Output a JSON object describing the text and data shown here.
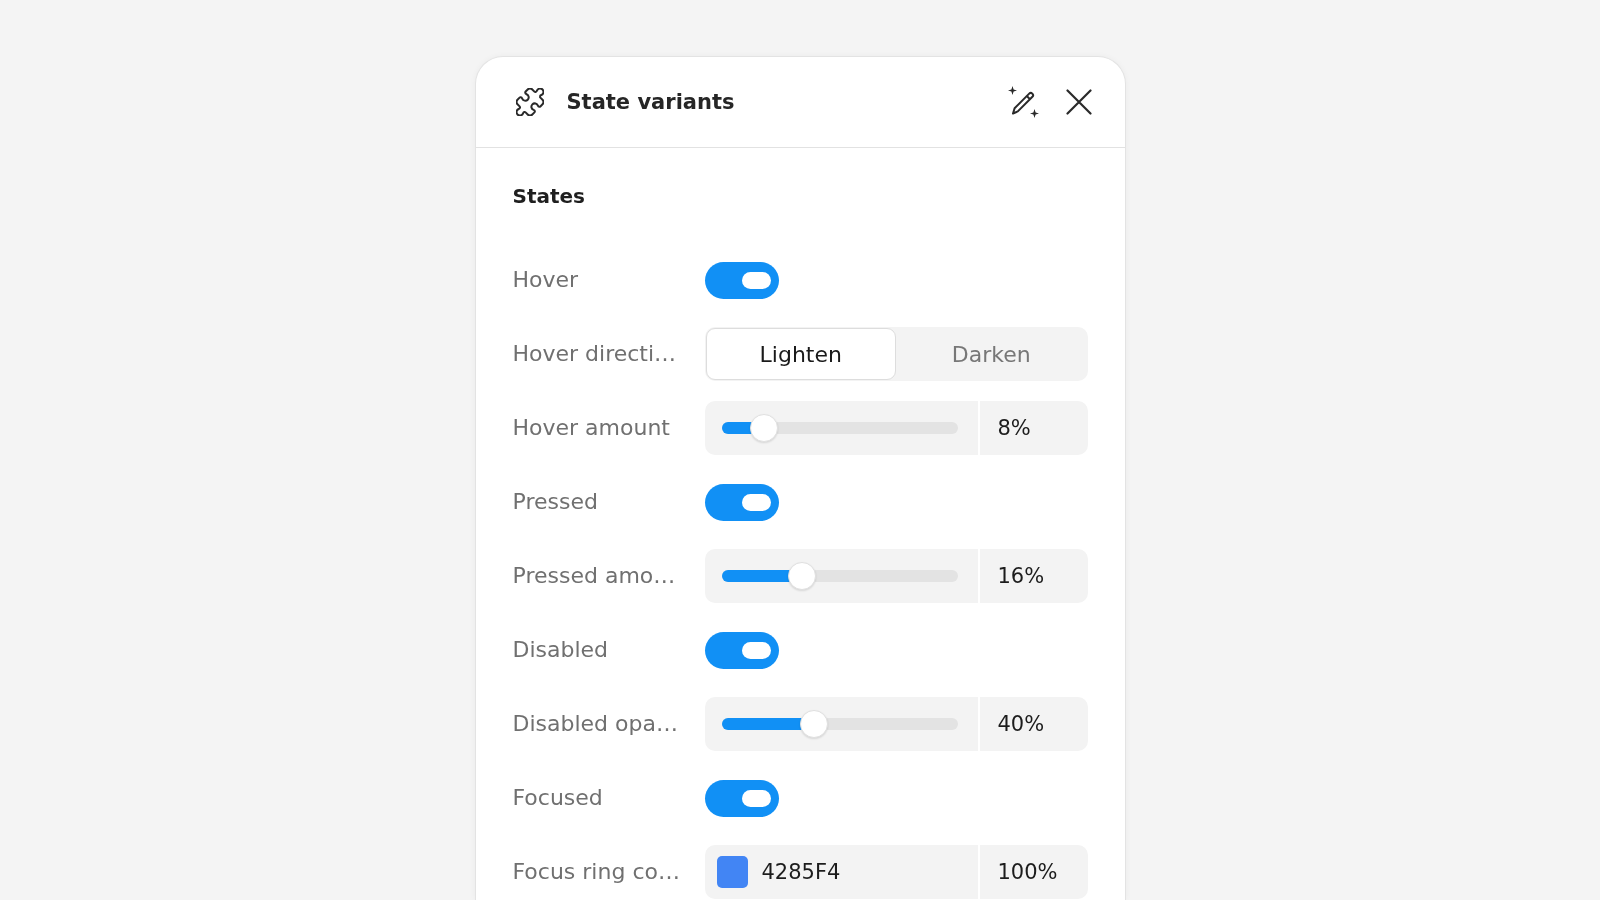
{
  "panel": {
    "title": "State variants"
  },
  "section": {
    "title": "States"
  },
  "rows": [
    {
      "kind": "toggle",
      "label": "Hover",
      "on": true
    },
    {
      "kind": "segmented",
      "label": "Hover directi…",
      "options": [
        {
          "label": "Lighten",
          "selected": true
        },
        {
          "label": "Darken",
          "selected": false
        }
      ]
    },
    {
      "kind": "slider",
      "label": "Hover amount",
      "level": 0.18,
      "value": "8%"
    },
    {
      "kind": "toggle",
      "label": "Pressed",
      "on": true
    },
    {
      "kind": "slider",
      "label": "Pressed amo…",
      "level": 0.34,
      "value": "16%"
    },
    {
      "kind": "toggle",
      "label": "Disabled",
      "on": true
    },
    {
      "kind": "slider",
      "label": "Disabled opa…",
      "level": 0.39,
      "value": "40%"
    },
    {
      "kind": "toggle",
      "label": "Focused",
      "on": true
    },
    {
      "kind": "color",
      "label": "Focus ring co…",
      "color": "#4285f4",
      "hex": "4285F4",
      "value": "100%"
    }
  ]
}
